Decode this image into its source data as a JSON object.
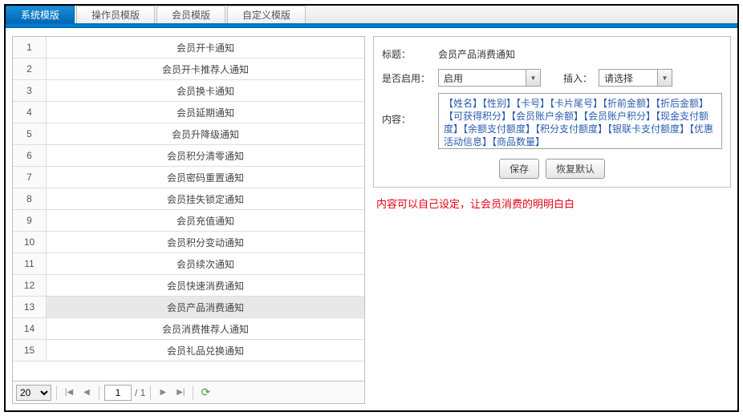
{
  "tabs": [
    {
      "label": "系统模版",
      "active": true
    },
    {
      "label": "操作员模版",
      "active": false
    },
    {
      "label": "会员模版",
      "active": false
    },
    {
      "label": "自定义模版",
      "active": false
    }
  ],
  "list": {
    "rows": [
      {
        "n": "1",
        "name": "会员开卡通知"
      },
      {
        "n": "2",
        "name": "会员开卡推荐人通知"
      },
      {
        "n": "3",
        "name": "会员换卡通知"
      },
      {
        "n": "4",
        "name": "会员延期通知"
      },
      {
        "n": "5",
        "name": "会员升降级通知"
      },
      {
        "n": "6",
        "name": "会员积分清零通知"
      },
      {
        "n": "7",
        "name": "会员密码重置通知"
      },
      {
        "n": "8",
        "name": "会员挂失锁定通知"
      },
      {
        "n": "9",
        "name": "会员充值通知"
      },
      {
        "n": "10",
        "name": "会员积分变动通知"
      },
      {
        "n": "11",
        "name": "会员续次通知"
      },
      {
        "n": "12",
        "name": "会员快速消费通知"
      },
      {
        "n": "13",
        "name": "会员产品消费通知"
      },
      {
        "n": "14",
        "name": "会员消费推荐人通知"
      },
      {
        "n": "15",
        "name": "会员礼品兑换通知"
      }
    ],
    "selected": 12
  },
  "pager": {
    "pageSize": "20",
    "page": "1",
    "total": "1"
  },
  "form": {
    "title_label": "标题：",
    "title_value": "会员产品消费通知",
    "enabled_label": "是否启用：",
    "enabled_value": "启用",
    "insert_label": "插入：",
    "insert_value": "请选择",
    "content_label": "内容：",
    "content_value": "【姓名】【性别】【卡号】【卡片尾号】【折前金额】【折后金额】【可获得积分】【会员账户余额】【会员账户积分】【现金支付额度】【余额支付额度】【积分支付额度】【银联卡支付额度】【优惠活动信息】【商品数量】",
    "save_label": "保存",
    "reset_label": "恢复默认"
  },
  "note": "内容可以自己设定，让会员消费的明明白白"
}
